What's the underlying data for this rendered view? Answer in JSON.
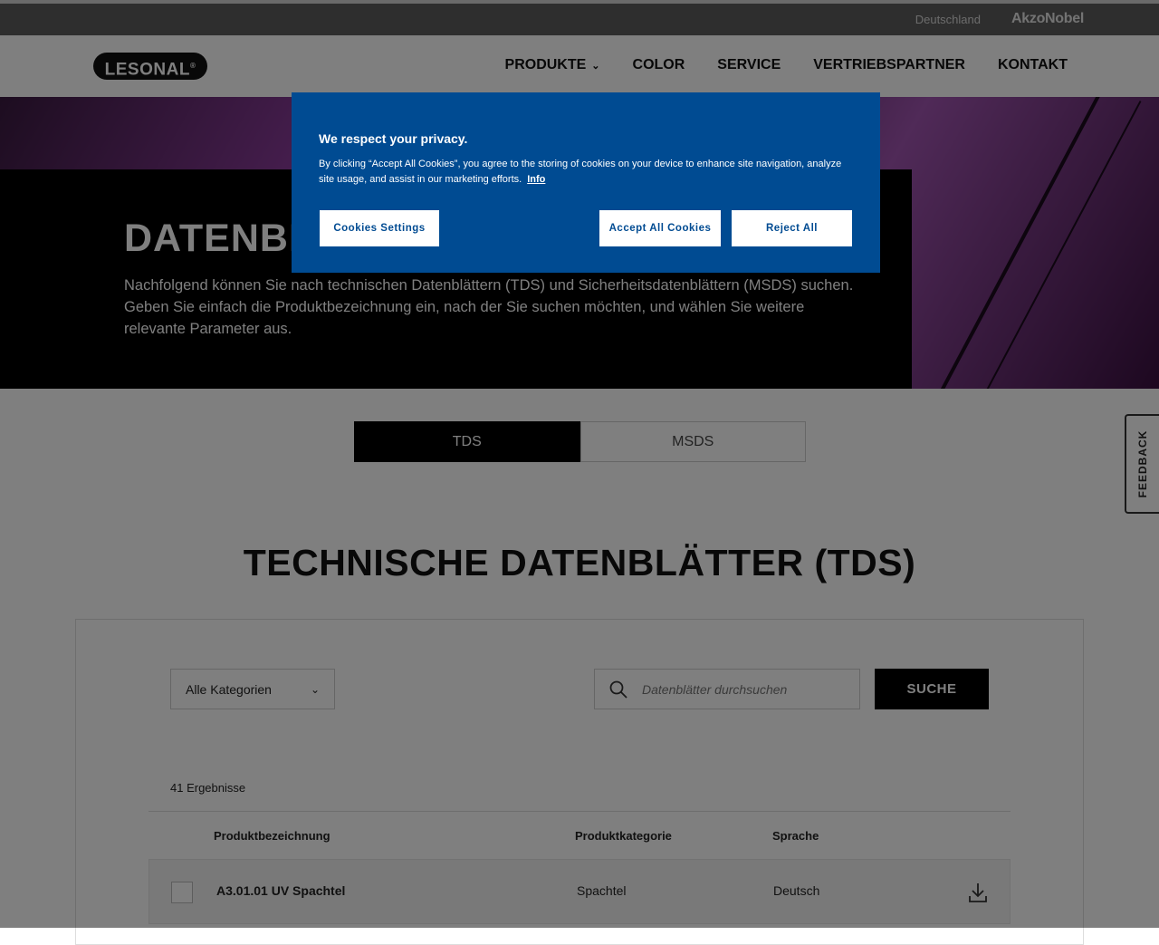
{
  "topbar": {
    "country": "Deutschland",
    "brand": "AkzoNobel"
  },
  "header": {
    "logo": "LESONAL",
    "logo_mark": "®",
    "nav": [
      "PRODUKTE",
      "COLOR",
      "SERVICE",
      "VERTRIEBSPARTNER",
      "KONTAKT"
    ]
  },
  "hero": {
    "title": "DATENBLÄTTER",
    "description": "Nachfolgend können Sie nach technischen Datenblättern (TDS) und Sicherheitsdatenblättern (MSDS) suchen. Geben Sie einfach die Produktbezeichnung ein, nach der Sie suchen möchten, und wählen Sie weitere relevante Parameter aus."
  },
  "tabs": [
    "TDS",
    "MSDS"
  ],
  "feedback": "FEEDBACK",
  "section_title": "TECHNISCHE DATENBLÄTTER (TDS)",
  "filters": {
    "category": "Alle Kategorien",
    "search_placeholder": "Datenblätter durchsuchen",
    "search_button": "SUCHE"
  },
  "results_count": "41 Ergebnisse",
  "table": {
    "headers": [
      "Produktbezeichnung",
      "Produktkategorie",
      "Sprache"
    ],
    "rows": [
      {
        "name": "A3.01.01 UV Spachtel",
        "category": "Spachtel",
        "language": "Deutsch"
      }
    ]
  },
  "cookie": {
    "title": "We respect your privacy.",
    "text": "By clicking “Accept All Cookies”, you agree to the storing of cookies on your device to enhance site navigation, analyze site usage, and assist in our marketing efforts.",
    "info_link": "Info",
    "settings_button": "Cookies Settings",
    "accept_button": "Accept All Cookies",
    "reject_button": "Reject All"
  },
  "colors": {
    "cookie_bg": "#004b92",
    "overlay": "rgba(0,0,0,0.5)",
    "hero_accent": "#8a3b9a"
  }
}
